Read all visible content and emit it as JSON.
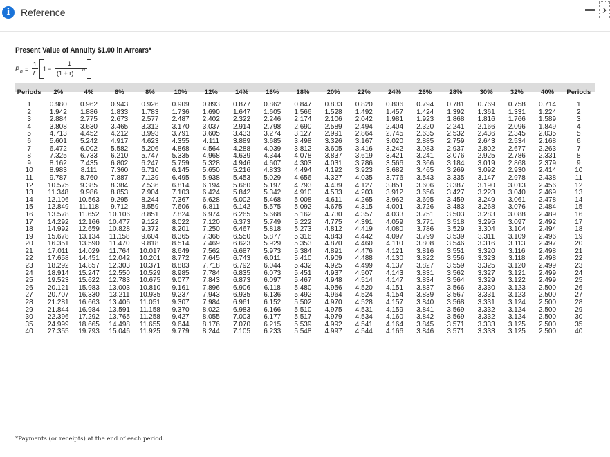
{
  "header": {
    "info_icon": "i",
    "title": "Reference",
    "next_icon": "›"
  },
  "table": {
    "title": "Present Value of Annuity $1.00 in Arrears*",
    "formula": {
      "lhs": "P",
      "sub": "n",
      "eq": "=",
      "one_a": "1",
      "r": "r",
      "one_b": "1",
      "minus": "−",
      "one_c": "1",
      "den": "(1 + r)",
      "exp": "n"
    },
    "columns": [
      "Periods",
      "2%",
      "4%",
      "6%",
      "8%",
      "10%",
      "12%",
      "14%",
      "16%",
      "18%",
      "20%",
      "22%",
      "24%",
      "26%",
      "28%",
      "30%",
      "32%",
      "40%",
      "Periods"
    ],
    "rows": [
      [
        "1",
        "0.980",
        "0.962",
        "0.943",
        "0.926",
        "0.909",
        "0.893",
        "0.877",
        "0.862",
        "0.847",
        "0.833",
        "0.820",
        "0.806",
        "0.794",
        "0.781",
        "0.769",
        "0.758",
        "0.714",
        "1"
      ],
      [
        "2",
        "1.942",
        "1.886",
        "1.833",
        "1.783",
        "1.736",
        "1.690",
        "1.647",
        "1.605",
        "1.566",
        "1.528",
        "1.492",
        "1.457",
        "1.424",
        "1.392",
        "1.361",
        "1.331",
        "1.224",
        "2"
      ],
      [
        "3",
        "2.884",
        "2.775",
        "2.673",
        "2.577",
        "2.487",
        "2.402",
        "2.322",
        "2.246",
        "2.174",
        "2.106",
        "2.042",
        "1.981",
        "1.923",
        "1.868",
        "1.816",
        "1.766",
        "1.589",
        "3"
      ],
      [
        "4",
        "3.808",
        "3.630",
        "3.465",
        "3.312",
        "3.170",
        "3.037",
        "2.914",
        "2.798",
        "2.690",
        "2.589",
        "2.494",
        "2.404",
        "2.320",
        "2.241",
        "2.166",
        "2.096",
        "1.849",
        "4"
      ],
      [
        "5",
        "4.713",
        "4.452",
        "4.212",
        "3.993",
        "3.791",
        "3.605",
        "3.433",
        "3.274",
        "3.127",
        "2.991",
        "2.864",
        "2.745",
        "2.635",
        "2.532",
        "2.436",
        "2.345",
        "2.035",
        "5"
      ],
      [
        "6",
        "5.601",
        "5.242",
        "4.917",
        "4.623",
        "4.355",
        "4.111",
        "3.889",
        "3.685",
        "3.498",
        "3.326",
        "3.167",
        "3.020",
        "2.885",
        "2.759",
        "2.643",
        "2.534",
        "2.168",
        "6"
      ],
      [
        "7",
        "6.472",
        "6.002",
        "5.582",
        "5.206",
        "4.868",
        "4.564",
        "4.288",
        "4.039",
        "3.812",
        "3.605",
        "3.416",
        "3.242",
        "3.083",
        "2.937",
        "2.802",
        "2.677",
        "2.263",
        "7"
      ],
      [
        "8",
        "7.325",
        "6.733",
        "6.210",
        "5.747",
        "5.335",
        "4.968",
        "4.639",
        "4.344",
        "4.078",
        "3.837",
        "3.619",
        "3.421",
        "3.241",
        "3.076",
        "2.925",
        "2.786",
        "2.331",
        "8"
      ],
      [
        "9",
        "8.162",
        "7.435",
        "6.802",
        "6.247",
        "5.759",
        "5.328",
        "4.946",
        "4.607",
        "4.303",
        "4.031",
        "3.786",
        "3.566",
        "3.366",
        "3.184",
        "3.019",
        "2.868",
        "2.379",
        "9"
      ],
      [
        "10",
        "8.983",
        "8.111",
        "7.360",
        "6.710",
        "6.145",
        "5.650",
        "5.216",
        "4.833",
        "4.494",
        "4.192",
        "3.923",
        "3.682",
        "3.465",
        "3.269",
        "3.092",
        "2.930",
        "2.414",
        "10"
      ],
      [
        "11",
        "9.787",
        "8.760",
        "7.887",
        "7.139",
        "6.495",
        "5.938",
        "5.453",
        "5.029",
        "4.656",
        "4.327",
        "4.035",
        "3.776",
        "3.543",
        "3.335",
        "3.147",
        "2.978",
        "2.438",
        "11"
      ],
      [
        "12",
        "10.575",
        "9.385",
        "8.384",
        "7.536",
        "6.814",
        "6.194",
        "5.660",
        "5.197",
        "4.793",
        "4.439",
        "4.127",
        "3.851",
        "3.606",
        "3.387",
        "3.190",
        "3.013",
        "2.456",
        "12"
      ],
      [
        "13",
        "11.348",
        "9.986",
        "8.853",
        "7.904",
        "7.103",
        "6.424",
        "5.842",
        "5.342",
        "4.910",
        "4.533",
        "4.203",
        "3.912",
        "3.656",
        "3.427",
        "3.223",
        "3.040",
        "2.469",
        "13"
      ],
      [
        "14",
        "12.106",
        "10.563",
        "9.295",
        "8.244",
        "7.367",
        "6.628",
        "6.002",
        "5.468",
        "5.008",
        "4.611",
        "4.265",
        "3.962",
        "3.695",
        "3.459",
        "3.249",
        "3.061",
        "2.478",
        "14"
      ],
      [
        "15",
        "12.849",
        "11.118",
        "9.712",
        "8.559",
        "7.606",
        "6.811",
        "6.142",
        "5.575",
        "5.092",
        "4.675",
        "4.315",
        "4.001",
        "3.726",
        "3.483",
        "3.268",
        "3.076",
        "2.484",
        "15"
      ],
      [
        "16",
        "13.578",
        "11.652",
        "10.106",
        "8.851",
        "7.824",
        "6.974",
        "6.265",
        "5.668",
        "5.162",
        "4.730",
        "4.357",
        "4.033",
        "3.751",
        "3.503",
        "3.283",
        "3.088",
        "2.489",
        "16"
      ],
      [
        "17",
        "14.292",
        "12.166",
        "10.477",
        "9.122",
        "8.022",
        "7.120",
        "6.373",
        "5.749",
        "5.222",
        "4.775",
        "4.391",
        "4.059",
        "3.771",
        "3.518",
        "3.295",
        "3.097",
        "2.492",
        "17"
      ],
      [
        "18",
        "14.992",
        "12.659",
        "10.828",
        "9.372",
        "8.201",
        "7.250",
        "6.467",
        "5.818",
        "5.273",
        "4.812",
        "4.419",
        "4.080",
        "3.786",
        "3.529",
        "3.304",
        "3.104",
        "2.494",
        "18"
      ],
      [
        "19",
        "15.678",
        "13.134",
        "11.158",
        "9.604",
        "8.365",
        "7.366",
        "6.550",
        "5.877",
        "5.316",
        "4.843",
        "4.442",
        "4.097",
        "3.799",
        "3.539",
        "3.311",
        "3.109",
        "2.496",
        "19"
      ],
      [
        "20",
        "16.351",
        "13.590",
        "11.470",
        "9.818",
        "8.514",
        "7.469",
        "6.623",
        "5.929",
        "5.353",
        "4.870",
        "4.460",
        "4.110",
        "3.808",
        "3.546",
        "3.316",
        "3.113",
        "2.497",
        "20"
      ],
      [
        "21",
        "17.011",
        "14.029",
        "11.764",
        "10.017",
        "8.649",
        "7.562",
        "6.687",
        "5.973",
        "5.384",
        "4.891",
        "4.476",
        "4.121",
        "3.816",
        "3.551",
        "3.320",
        "3.116",
        "2.498",
        "21"
      ],
      [
        "22",
        "17.658",
        "14.451",
        "12.042",
        "10.201",
        "8.772",
        "7.645",
        "6.743",
        "6.011",
        "5.410",
        "4.909",
        "4.488",
        "4.130",
        "3.822",
        "3.556",
        "3.323",
        "3.118",
        "2.498",
        "22"
      ],
      [
        "23",
        "18.292",
        "14.857",
        "12.303",
        "10.371",
        "8.883",
        "7.718",
        "6.792",
        "6.044",
        "5.432",
        "4.925",
        "4.499",
        "4.137",
        "3.827",
        "3.559",
        "3.325",
        "3.120",
        "2.499",
        "23"
      ],
      [
        "24",
        "18.914",
        "15.247",
        "12.550",
        "10.529",
        "8.985",
        "7.784",
        "6.835",
        "6.073",
        "5.451",
        "4.937",
        "4.507",
        "4.143",
        "3.831",
        "3.562",
        "3.327",
        "3.121",
        "2.499",
        "24"
      ],
      [
        "25",
        "19.523",
        "15.622",
        "12.783",
        "10.675",
        "9.077",
        "7.843",
        "6.873",
        "6.097",
        "5.467",
        "4.948",
        "4.514",
        "4.147",
        "3.834",
        "3.564",
        "3.329",
        "3.122",
        "2.499",
        "25"
      ],
      [
        "26",
        "20.121",
        "15.983",
        "13.003",
        "10.810",
        "9.161",
        "7.896",
        "6.906",
        "6.118",
        "5.480",
        "4.956",
        "4.520",
        "4.151",
        "3.837",
        "3.566",
        "3.330",
        "3.123",
        "2.500",
        "26"
      ],
      [
        "27",
        "20.707",
        "16.330",
        "13.211",
        "10.935",
        "9.237",
        "7.943",
        "6.935",
        "6.136",
        "5.492",
        "4.964",
        "4.524",
        "4.154",
        "3.839",
        "3.567",
        "3.331",
        "3.123",
        "2.500",
        "27"
      ],
      [
        "28",
        "21.281",
        "16.663",
        "13.406",
        "11.051",
        "9.307",
        "7.984",
        "6.961",
        "6.152",
        "5.502",
        "4.970",
        "4.528",
        "4.157",
        "3.840",
        "3.568",
        "3.331",
        "3.124",
        "2.500",
        "28"
      ],
      [
        "29",
        "21.844",
        "16.984",
        "13.591",
        "11.158",
        "9.370",
        "8.022",
        "6.983",
        "6.166",
        "5.510",
        "4.975",
        "4.531",
        "4.159",
        "3.841",
        "3.569",
        "3.332",
        "3.124",
        "2.500",
        "29"
      ],
      [
        "30",
        "22.396",
        "17.292",
        "13.765",
        "11.258",
        "9.427",
        "8.055",
        "7.003",
        "6.177",
        "5.517",
        "4.979",
        "4.534",
        "4.160",
        "3.842",
        "3.569",
        "3.332",
        "3.124",
        "2.500",
        "30"
      ],
      [
        "35",
        "24.999",
        "18.665",
        "14.498",
        "11.655",
        "9.644",
        "8.176",
        "7.070",
        "6.215",
        "5.539",
        "4.992",
        "4.541",
        "4.164",
        "3.845",
        "3.571",
        "3.333",
        "3.125",
        "2.500",
        "35"
      ],
      [
        "40",
        "27.355",
        "19.793",
        "15.046",
        "11.925",
        "9.779",
        "8.244",
        "7.105",
        "6.233",
        "5.548",
        "4.997",
        "4.544",
        "4.166",
        "3.846",
        "3.571",
        "3.333",
        "3.125",
        "2.500",
        "40"
      ]
    ],
    "footnote": "*Payments (or receipts) at the end of each period."
  }
}
